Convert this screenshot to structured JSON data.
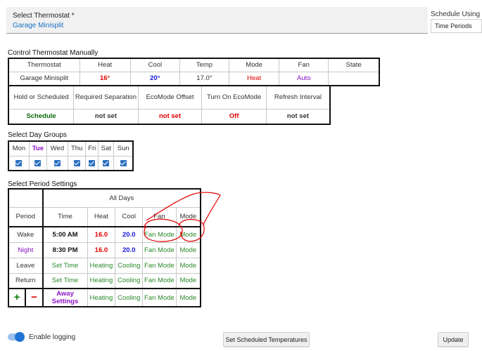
{
  "thermostat_select": {
    "label": "Select Thermostat *",
    "value": "Garage Minisplit"
  },
  "schedule_using": {
    "label": "Schedule Using",
    "value": "Time Periods"
  },
  "control_manual": {
    "title": "Control Thermostat Manually",
    "headers": [
      "Thermostat",
      "Heat",
      "Cool",
      "Temp",
      "Mode",
      "Fan",
      "State"
    ],
    "values": [
      "Garage Minisplit",
      "16°",
      "20°",
      "17.0°",
      "Heat",
      "Auto",
      ""
    ],
    "headers2": [
      "Hold or Scheduled",
      "Required Separation",
      "EcoMode Offset",
      "Turn On EcoMode",
      "Refresh Interval"
    ],
    "values2": [
      "Schedule",
      "not set",
      "not set",
      "Off",
      "not set"
    ]
  },
  "day_groups": {
    "title": "Select Day Groups",
    "days": [
      "Mon",
      "Tue",
      "Wed",
      "Thu",
      "Fri",
      "Sat",
      "Sun"
    ]
  },
  "period_settings": {
    "title": "Select Period Settings",
    "group_header": "All Days",
    "headers": [
      "Period",
      "Time",
      "Heat",
      "Cool",
      "Fan",
      "Mode"
    ],
    "rows": [
      [
        "Wake",
        "5:00 AM",
        "16.0",
        "20.0",
        "Fan Mode",
        "Mode"
      ],
      [
        "Night",
        "8:30 PM",
        "16.0",
        "20.0",
        "Fan Mode",
        "Mode"
      ],
      [
        "Leave",
        "Set Time",
        "Heating",
        "Cooling",
        "Fan Mode",
        "Mode"
      ],
      [
        "Return",
        "Set Time",
        "Heating",
        "Cooling",
        "Fan Mode",
        "Mode"
      ]
    ],
    "add_symbol": "+",
    "remove_symbol": "−",
    "away": [
      "Away Settings",
      "Heating",
      "Cooling",
      "Fan Mode",
      "Mode"
    ]
  },
  "logging": {
    "label": "Enable logging",
    "enabled": true
  },
  "buttons": {
    "set_scheduled": "Set Scheduled Temperatures",
    "update": "Update"
  },
  "colors": {
    "heat": "#e00000",
    "cool": "#1515d6",
    "accent": "#1f73d6",
    "green": "#2a8a2a",
    "purple": "#8a12c6",
    "annotation": "#e00000"
  }
}
